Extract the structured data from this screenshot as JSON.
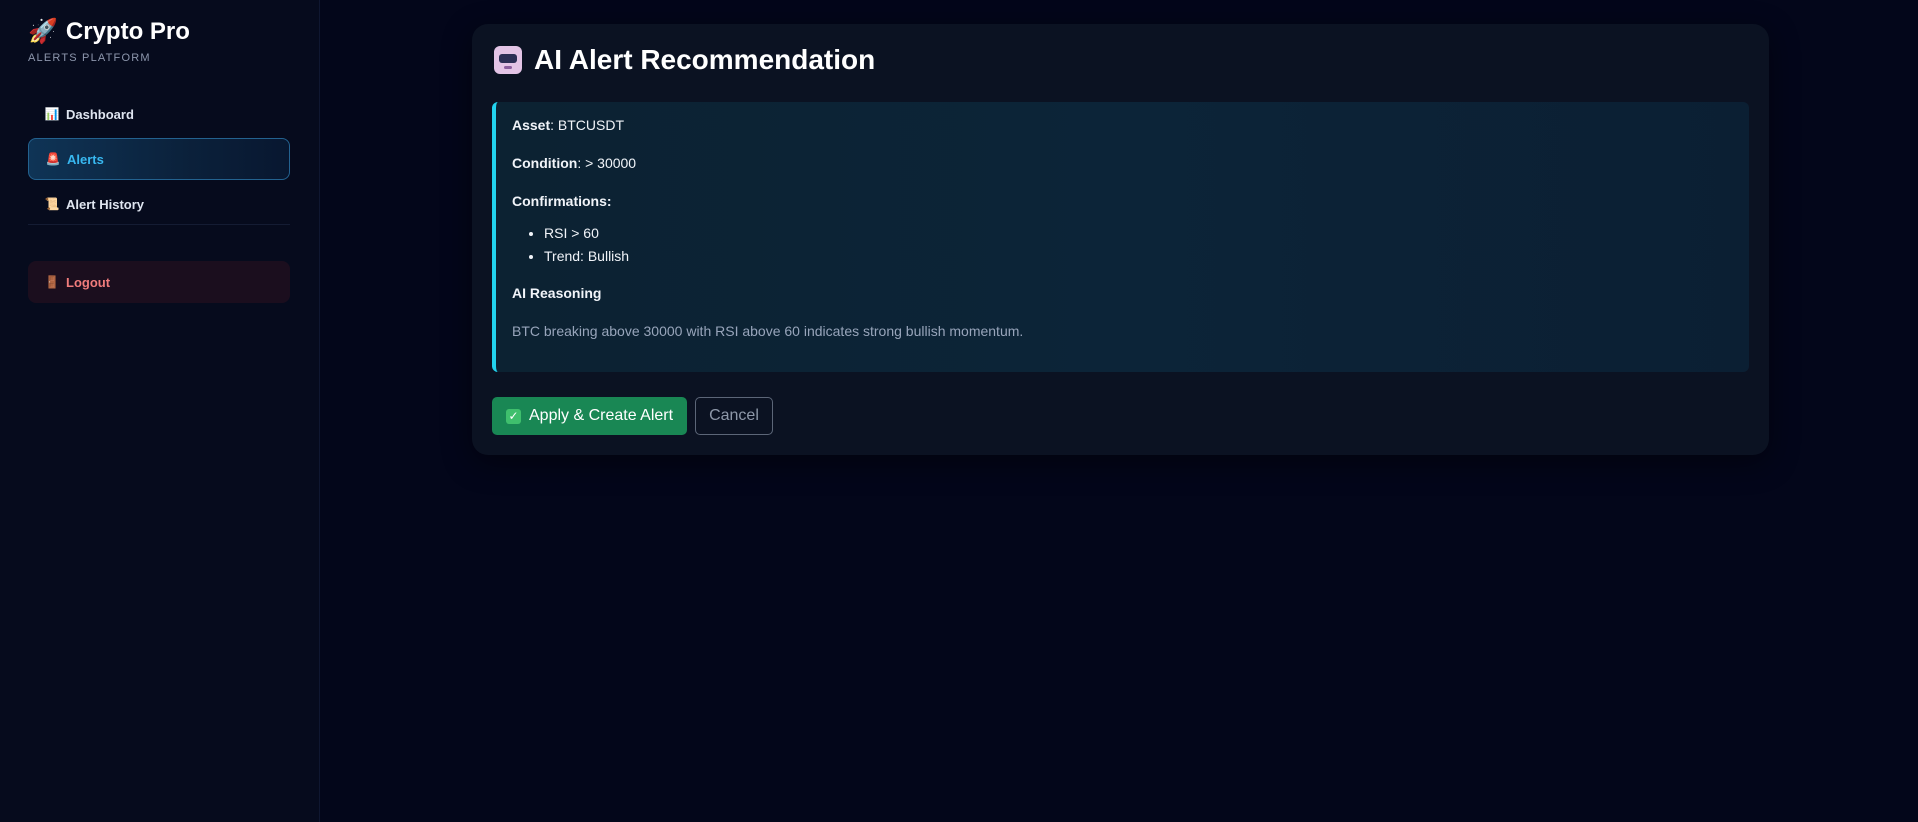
{
  "brand": {
    "icon": "🚀",
    "title": "Crypto Pro",
    "subtitle": "ALERTS PLATFORM"
  },
  "nav": {
    "dashboard": {
      "icon": "📊",
      "label": "Dashboard"
    },
    "alerts": {
      "icon": "🚨",
      "label": "Alerts",
      "active": true
    },
    "history": {
      "icon": "📜",
      "label": "Alert History"
    },
    "logout": {
      "icon": "🚪",
      "label": "Logout"
    }
  },
  "card": {
    "title": "AI Alert Recommendation",
    "icon": "robot-icon",
    "asset_label": "Asset",
    "asset_value": ": BTCUSDT",
    "condition_label": "Condition",
    "condition_value": ": > 30000",
    "confirmations_label": "Confirmations:",
    "confirmations": [
      "RSI > 60",
      "Trend: Bullish"
    ],
    "reasoning_label": "AI Reasoning",
    "reasoning_text": "BTC breaking above 30000 with RSI above 60 indicates strong bullish momentum."
  },
  "actions": {
    "apply_icon": "✓",
    "apply_label": "Apply & Create Alert",
    "cancel_label": "Cancel"
  },
  "colors": {
    "accent": "#22d3ee",
    "apply": "#198754",
    "logout": "#f07c7c",
    "active_nav": "#38b8f0"
  }
}
